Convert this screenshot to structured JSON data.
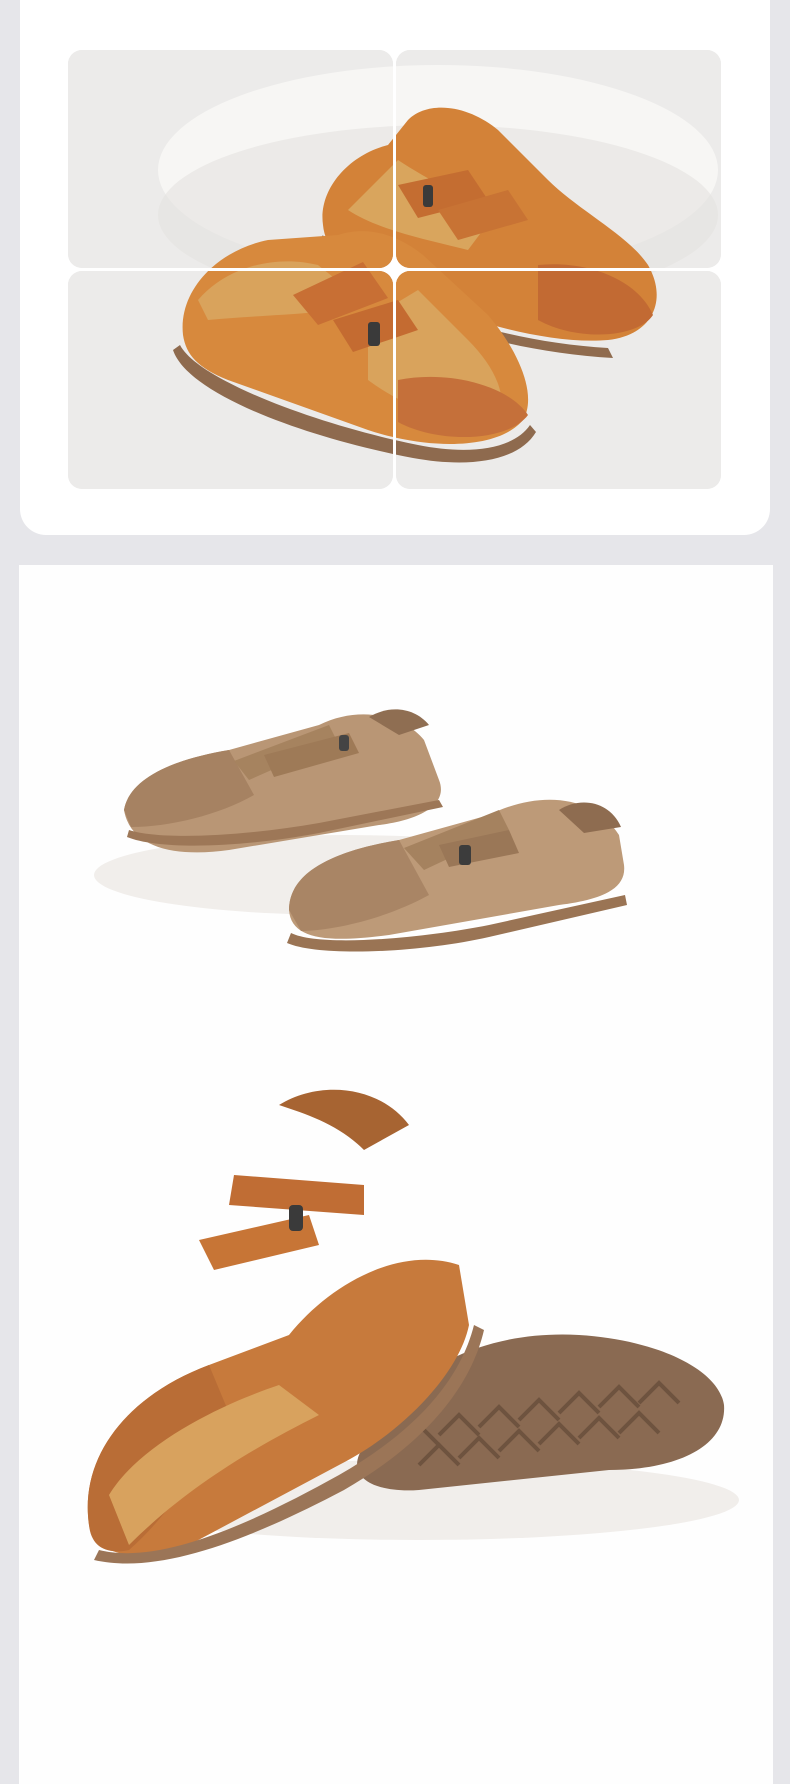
{
  "gallery": {
    "tiles": [
      "photo-tile",
      "photo-tile",
      "photo-tile",
      "photo-tile"
    ],
    "backdrop": "#ecebea",
    "pedestal": "#f6f5f3"
  },
  "colors": {
    "orange_suede": "#d6833a",
    "tan_leather": "#d9a35c",
    "toe_cap": "#c26a33",
    "sole": "#9a7556",
    "khaki_suede": "#b89572",
    "khaki_toe": "#a98463",
    "strap": "#c8783a"
  },
  "icons": [
    "shoe-pair-photo",
    "shoe-pair-photo-khaki",
    "shoe-sole-photo"
  ]
}
